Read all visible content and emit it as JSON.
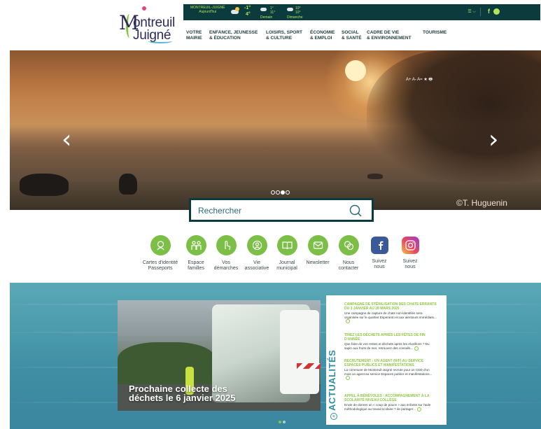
{
  "logo": {
    "line1": "ontreuil",
    "line2": "Juigné",
    "initial": "M"
  },
  "topbar": {
    "today": {
      "place": "MONTREUIL-JUIGNÉ",
      "day": "Aujourd'hui",
      "t_min": "-1°",
      "t_max": "4°"
    },
    "tomorrow": {
      "day": "Demain",
      "t_min": "1°",
      "t_max": "11°"
    },
    "after": {
      "day": "Dimanche",
      "t_min": "10°",
      "t_max": "10°"
    },
    "menu_label": "☰ ⌵",
    "facebook": "f"
  },
  "nav": [
    {
      "l1": "VOTRE",
      "l2": "MAIRIE"
    },
    {
      "l1": "ENFANCE, JEUNESSE",
      "l2": "& ÉDUCATION"
    },
    {
      "l1": "LOISIRS, SPORT",
      "l2": "& CULTURE"
    },
    {
      "l1": "ÉCONOMIE",
      "l2": "& EMPLOI"
    },
    {
      "l1": "SOCIAL",
      "l2": "& SANTÉ"
    },
    {
      "l1": "CADRE DE VIE",
      "l2": "& ENVIRONNEMENT"
    },
    {
      "l1": "TOURISME",
      "l2": ""
    }
  ],
  "hero": {
    "credit": "©T. Huguenin",
    "tools": "A+ A- A= ★ 🖶",
    "prev": "‹",
    "next": "›",
    "slides": 4,
    "active_slide": 3
  },
  "search": {
    "placeholder": "Rechercher"
  },
  "quick_links": [
    {
      "l1": "Cartes d'identité",
      "l2": "Passeports",
      "icon": "id-card-icon"
    },
    {
      "l1": "Espace",
      "l2": "familles",
      "icon": "family-icon"
    },
    {
      "l1": "Vos",
      "l2": "démarches",
      "icon": "hand-pointer-icon"
    },
    {
      "l1": "Vie",
      "l2": "associative",
      "icon": "association-icon"
    },
    {
      "l1": "Journal",
      "l2": "municipal",
      "icon": "book-icon"
    },
    {
      "l1": "Newsletter",
      "l2": "",
      "icon": "mail-icon"
    },
    {
      "l1": "Nous",
      "l2": "contacter",
      "icon": "chat-icon"
    },
    {
      "l1": "Suivez",
      "l2": "nous",
      "icon": "facebook-icon"
    },
    {
      "l1": "Suivez",
      "l2": "nous",
      "icon": "instagram-icon"
    }
  ],
  "feature": {
    "title_l1": "Prochaine collecte des",
    "title_l2": "déchets le 6 janvier 2025"
  },
  "news": {
    "label": "ACTUALITÉS",
    "items": [
      {
        "title": "Campagne de stérilisation des chats errants du 3 janvier au 28 mars 2025",
        "body": "Une campagne de capture de chats non-identifiés sera organisée sur le quartier Esperanto et aux alentours immédiats..."
      },
      {
        "title": "Triez les déchets après les fêtes de fin d'année",
        "body": "Que faire de vos restes et déchets après les réveillons ? Du sapin aux fruits de mer, retrouvez des conseils..."
      },
      {
        "title": "Recrutement : un agent (H/F) au service Espaces publics et manifestations",
        "body": "La commune de Montreuil-Juigné recrute pour un CDD d'un mois un agent au service Espaces publics et manifestations..."
      },
      {
        "title": "Appel à bénévoles : accompagnement à la scolarité niveau collège",
        "body": "Envie de donner un « coup de pouce » aux enfants sur l'aide méthodologique au travail scolaire ? de partager..."
      }
    ]
  }
}
